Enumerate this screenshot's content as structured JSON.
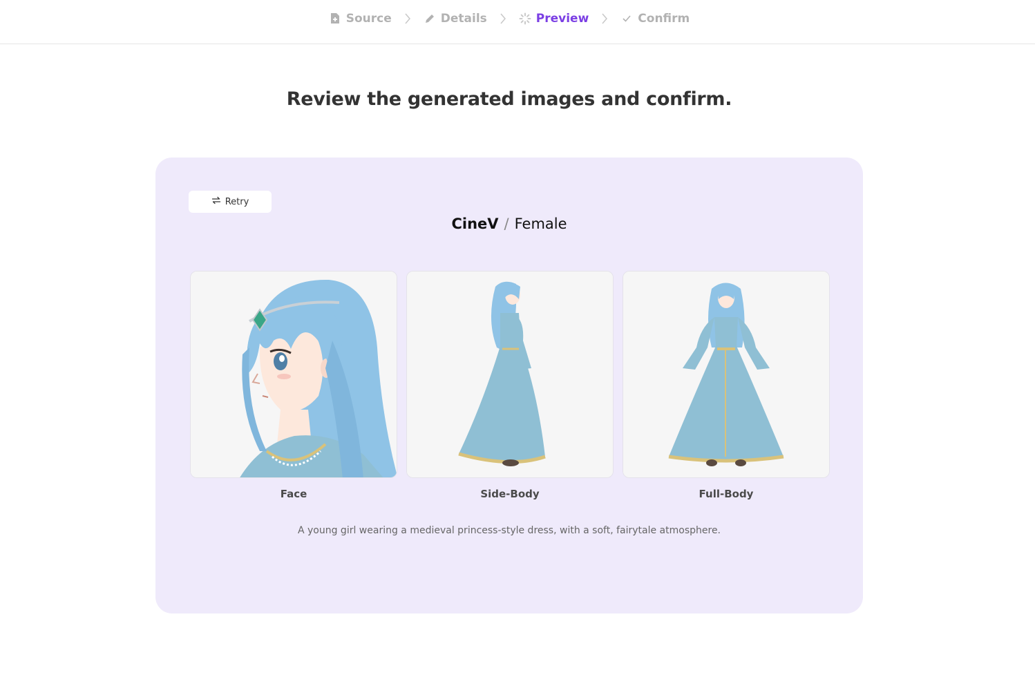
{
  "stepper": {
    "steps": [
      {
        "label": "Source",
        "icon": "file-plus-icon",
        "state": "done"
      },
      {
        "label": "Details",
        "icon": "pencil-icon",
        "state": "done"
      },
      {
        "label": "Preview",
        "icon": "spinner-icon",
        "state": "active"
      },
      {
        "label": "Confirm",
        "icon": "check-icon",
        "state": "pending"
      }
    ]
  },
  "headline": "Review the generated images and confirm.",
  "card": {
    "retry_label": "Retry",
    "model": {
      "brand": "CineV",
      "category": "Female"
    },
    "images": [
      {
        "caption": "Face",
        "subject": "anime girl face profile with blue hair and tiara"
      },
      {
        "caption": "Side-Body",
        "subject": "anime girl side view in long blue dress"
      },
      {
        "caption": "Full-Body",
        "subject": "anime girl front view in long blue dress"
      }
    ],
    "description": "A young girl wearing a medieval princess-style dress, with a soft, fairytale atmosphere."
  },
  "colors": {
    "accent": "#7b3fe4",
    "inactive": "#b2b2b2",
    "card_bg": "#efeafb",
    "hair": "#8fc3e6",
    "dress": "#8fbfd4"
  }
}
